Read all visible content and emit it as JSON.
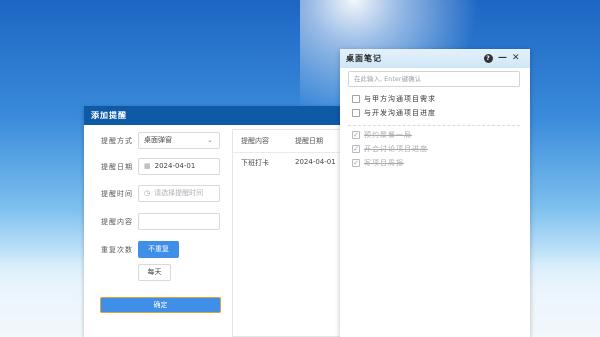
{
  "reminder_dialog": {
    "title": "添加提醒",
    "fields": {
      "method": {
        "label": "提醒方式",
        "value": "桌面弹窗"
      },
      "date": {
        "label": "提醒日期",
        "value": "2024-04-01"
      },
      "time": {
        "label": "提醒时间",
        "placeholder": "请选择提醒时间"
      },
      "content": {
        "label": "提醒内容",
        "value": ""
      },
      "repeat": {
        "label": "重复次数",
        "options": [
          "不重复",
          "每天"
        ],
        "selected": "不重复"
      }
    },
    "confirm_label": "确定",
    "list": {
      "columns": [
        "提醒内容",
        "提醒日期"
      ],
      "rows": [
        {
          "content": "下班打卡",
          "date": "2024-04-01"
        }
      ]
    }
  },
  "notes_panel": {
    "title": "桌面笔记",
    "input_placeholder": "在此输入, Enter键确认",
    "todos": [
      {
        "text": "与甲方沟通项目需求",
        "done": false
      },
      {
        "text": "与开发沟通项目进度",
        "done": false
      }
    ],
    "completed": [
      {
        "text": "预约聚餐一局",
        "done": true
      },
      {
        "text": "开会讨论项目进度",
        "done": true
      },
      {
        "text": "写项目周报",
        "done": true
      }
    ],
    "icons": [
      "help-icon",
      "minimize-icon",
      "close-icon"
    ]
  },
  "colors": {
    "title_bar": "#0f5aa6",
    "accent": "#3f8fe8",
    "notes_header": "#cfe6f7"
  }
}
